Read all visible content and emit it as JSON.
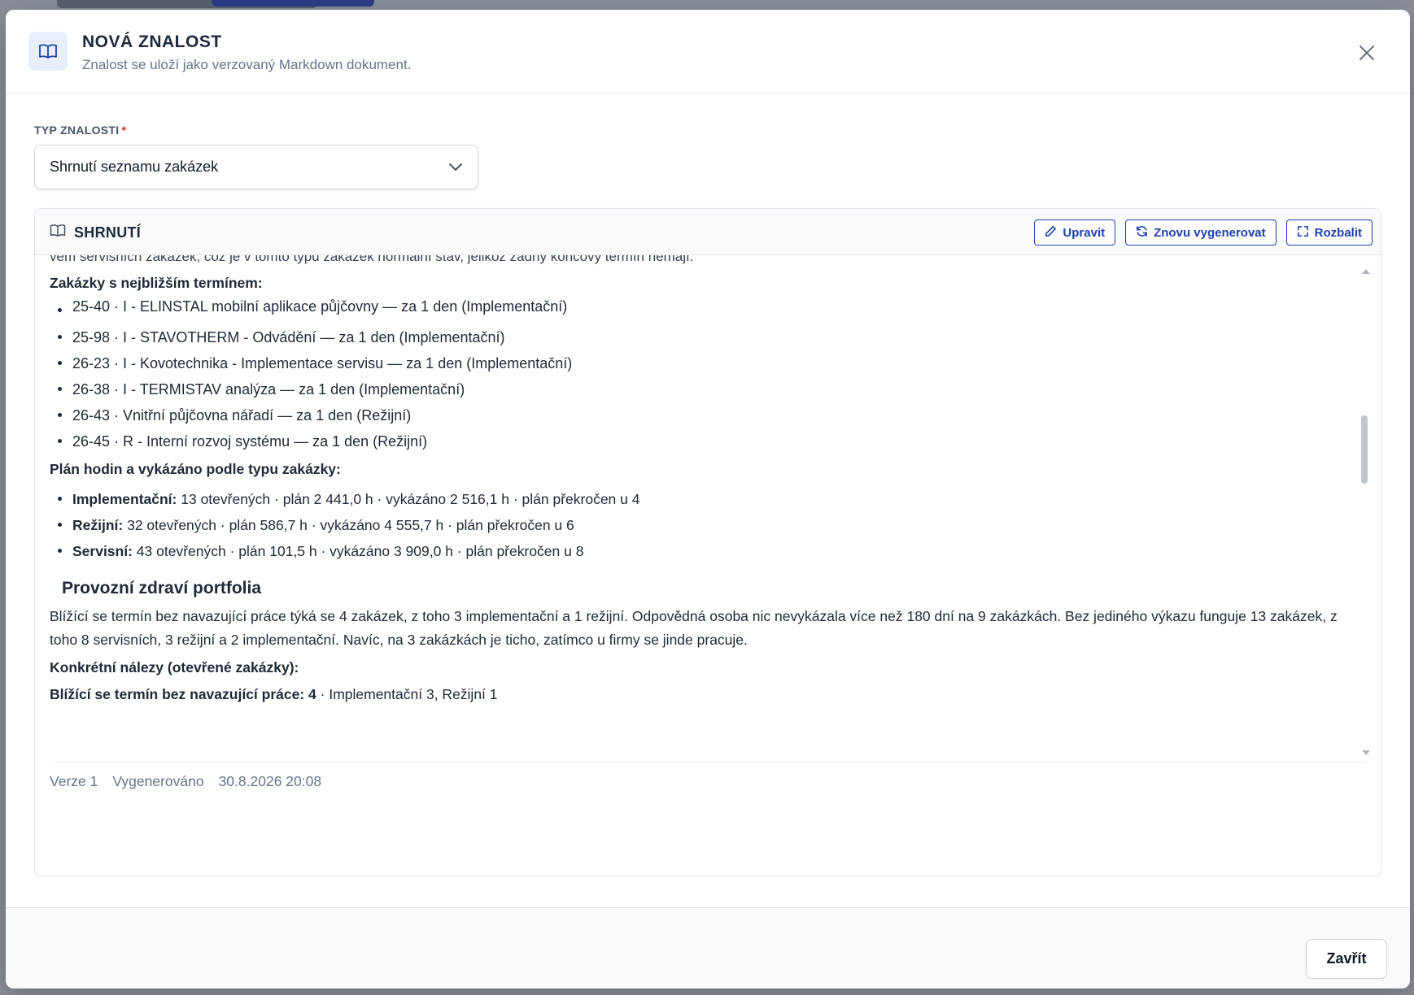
{
  "modal": {
    "title": "NOVÁ ZNALOST",
    "subtitle": "Znalost se uloží jako verzovaný Markdown dokument.",
    "close_icon": "close-icon"
  },
  "form": {
    "type_label": "TYP ZNALOSTI",
    "required_mark": "*",
    "type_value": "Shrnutí seznamu zakázek"
  },
  "panel": {
    "title": "SHRNUTÍ",
    "edit_label": "Upravit",
    "regenerate_label": "Znovu vygenerovat",
    "expand_label": "Rozbalit"
  },
  "content": {
    "cut_line": "vem servisních zakázek, což je v tomto typu zakázek normální stav, jelikož žádný koncový termín nemají.",
    "nearest_heading": "Zakázky s nejbližším termínem:",
    "nearest_items": [
      "25-40 · I - ELINSTAL mobilní aplikace půjčovny — za 1 den (Implementační)",
      "25-98 · I - STAVOTHERM - Odvádění — za 1 den (Implementační)",
      "26-23 · I - Kovotechnika - Implementace servisu — za 1 den (Implementační)",
      "26-38 · I - TERMISTAV analýza — za 1 den (Implementační)",
      "26-43 · Vnitřní půjčovna nářadí — za 1 den (Režijní)",
      "26-45 · R - Interní rozvoj systému — za 1 den (Režijní)"
    ],
    "plan_heading": "Plán hodin a vykázáno podle typu zakázky:",
    "plan_items": [
      {
        "label": "Implementační:",
        "text": " 13 otevřených · plán 2 441,0 h · vykázáno 2 516,1 h · plán překročen u 4"
      },
      {
        "label": "Režijní:",
        "text": " 32 otevřených · plán 586,7 h · vykázáno 4 555,7 h · plán překročen u 6"
      },
      {
        "label": "Servisní:",
        "text": " 43 otevřených · plán 101,5 h · vykázáno 3 909,0 h · plán překročen u 8"
      }
    ],
    "health_heading": "Provozní zdraví portfolia",
    "health_paragraph": "Blížící se termín bez navazující práce týká se 4 zakázek, z toho 3 implementační a 1 režijní. Odpovědná osoba nic nevykázala více než 180 dní na 9 zakázkách. Bez jediného výkazu funguje 13 zakázek, z toho 8 servisních, 3 režijní a 2 implementační. Navíc, na 3 zakázkách je ticho, zatímco u firmy se jinde pracuje.",
    "findings_heading": "Konkrétní nálezy (otevřené zakázky):",
    "finding_label": "Blížící se termín bez navazující práce: 4",
    "finding_text": " · Implementační 3, Režijní 1"
  },
  "meta": {
    "version": "Verze 1",
    "generated_label": "Vygenerováno",
    "generated_at": "30.8.2026 20:08"
  },
  "footer": {
    "close_label": "Zavřít"
  }
}
